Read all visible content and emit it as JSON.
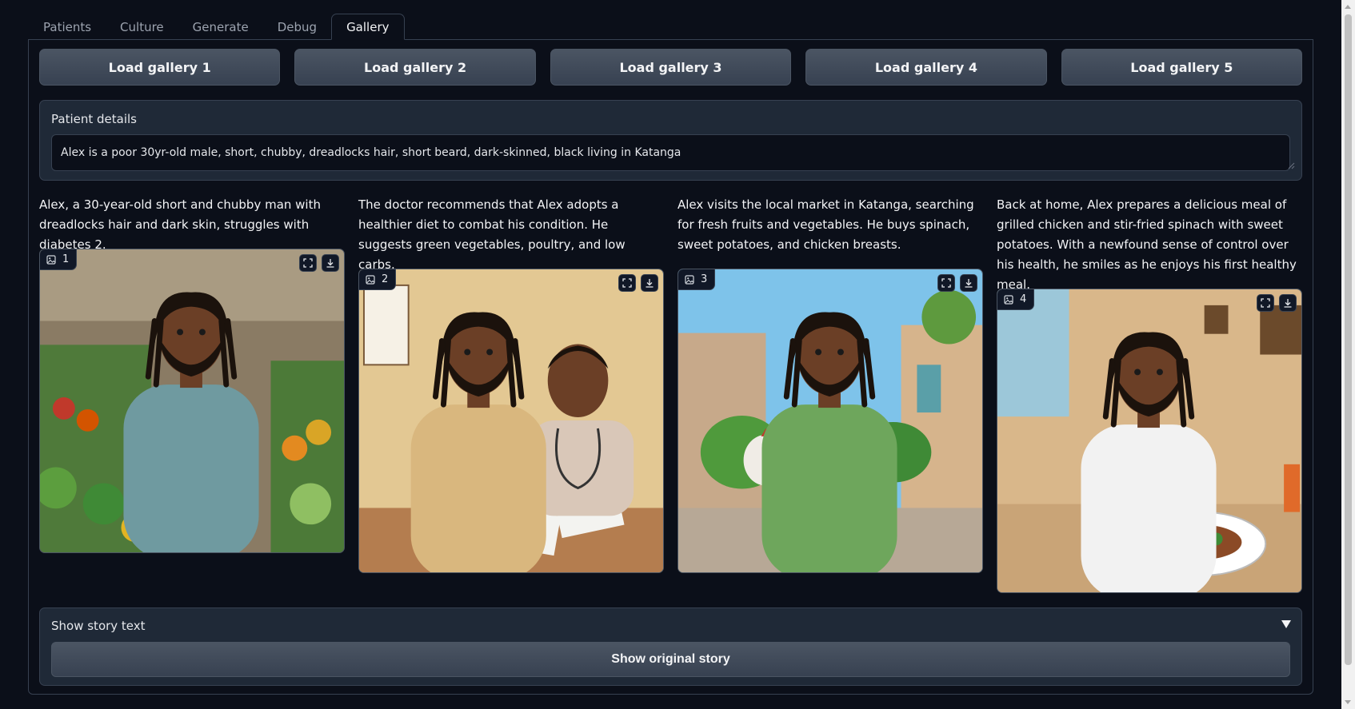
{
  "tabs": [
    {
      "label": "Patients"
    },
    {
      "label": "Culture"
    },
    {
      "label": "Generate"
    },
    {
      "label": "Debug"
    },
    {
      "label": "Gallery",
      "active": true
    }
  ],
  "load_buttons": [
    "Load gallery 1",
    "Load gallery 2",
    "Load gallery 3",
    "Load gallery 4",
    "Load gallery 5"
  ],
  "patient_details": {
    "label": "Patient details",
    "value": "Alex is a poor 30yr-old male, short, chubby, dreadlocks hair, short beard, dark-skinned, black living in Katanga"
  },
  "panels": [
    {
      "index": "1",
      "text": "Alex, a 30-year-old short and chubby man with dreadlocks hair and dark skin, struggles with diabetes 2.",
      "scene": "market-produce",
      "shirt_color": "#6f9aa0"
    },
    {
      "index": "2",
      "text": "The doctor recommends that Alex adopts a healthier diet to combat his condition. He suggests green vegetables, poultry, and low carbs.",
      "scene": "doctor-office",
      "shirt_color": "#d9b77e"
    },
    {
      "index": "3",
      "text": "Alex visits the local market in Katanga, searching for fresh fruits and vegetables. He buys spinach, sweet potatoes, and chicken breasts.",
      "scene": "street-market",
      "shirt_color": "#6ea65c"
    },
    {
      "index": "4",
      "text": "Back at home, Alex prepares a delicious meal of grilled chicken and stir-fried spinach with sweet potatoes. With a newfound sense of control over his health, he smiles as he enjoys his first healthy meal.",
      "scene": "home-meal",
      "shirt_color": "#f2f2f2"
    }
  ],
  "story": {
    "label": "Show story text",
    "button": "Show original story"
  },
  "colors": {
    "background": "#0b0f19",
    "block": "#1f2937",
    "border": "#374151",
    "button": "#4b5563"
  }
}
